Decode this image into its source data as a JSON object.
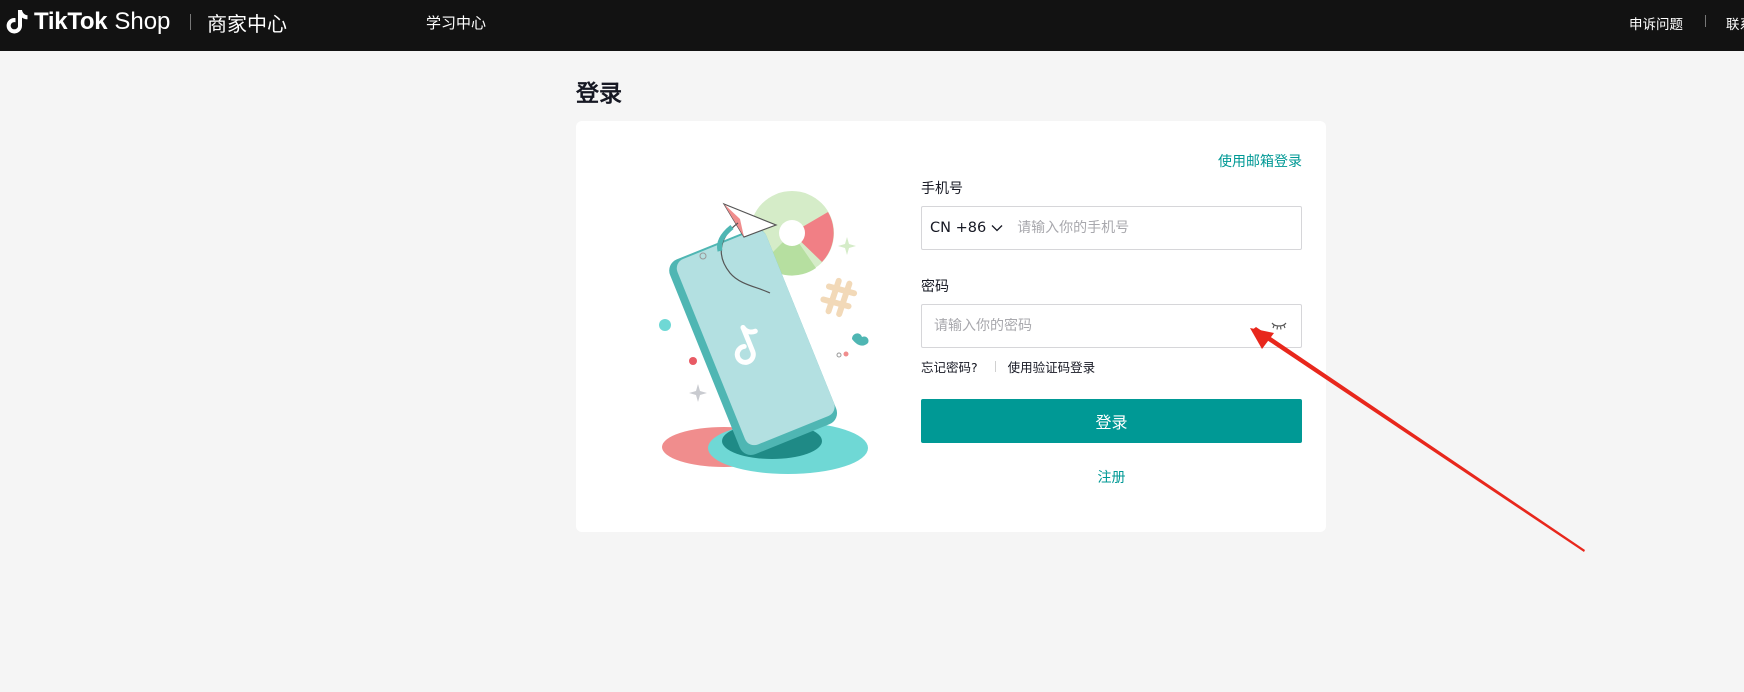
{
  "header": {
    "brand_tiktok": "TikTok",
    "brand_shop": "Shop",
    "brand_center": "商家中心",
    "nav_learning": "学习中心",
    "nav_appeal": "申诉问题",
    "nav_contact": "联系"
  },
  "page": {
    "title": "登录"
  },
  "login_form": {
    "email_login_link": "使用邮箱登录",
    "phone_label": "手机号",
    "country_code": "CN +86",
    "phone_placeholder": "请输入你的手机号",
    "phone_value": "",
    "password_label": "密码",
    "password_placeholder": "请输入你的密码",
    "password_value": "",
    "forgot_password": "忘记密码?",
    "verification_login": "使用验证码登录",
    "submit_label": "登录",
    "register_link": "注册"
  },
  "colors": {
    "accent": "#009995",
    "header_bg": "#121212",
    "page_bg": "#f5f5f5",
    "annotation_arrow": "#e8271c"
  },
  "icons": {
    "logo": "tiktok-note-icon",
    "country_dropdown": "chevron-down-icon",
    "password_toggle": "eye-closed-icon",
    "annotation": "red-arrow-annotation"
  }
}
